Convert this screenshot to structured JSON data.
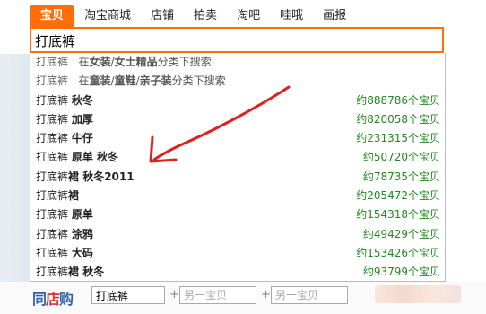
{
  "tabs": [
    "宝贝",
    "淘宝商城",
    "店铺",
    "拍卖",
    "淘吧",
    "哇哦",
    "画报"
  ],
  "search": {
    "value": "打底裤"
  },
  "categories": [
    {
      "term": "打底裤",
      "prefix": "在",
      "cats": [
        "女装",
        "女士精品"
      ],
      "suffix": "分类下搜索"
    },
    {
      "term": "打底裤",
      "prefix": "在",
      "cats": [
        "童装",
        "童鞋",
        "亲子装"
      ],
      "suffix": "分类下搜索"
    }
  ],
  "suggestions": [
    {
      "base": "打底裤",
      "extra": "秋冬",
      "count": "约888786个宝贝"
    },
    {
      "base": "打底裤",
      "extra": "加厚",
      "count": "约820058个宝贝"
    },
    {
      "base": "打底裤",
      "extra": "牛仔",
      "count": "约231315个宝贝"
    },
    {
      "base": "打底裤",
      "extra": "原单 秋冬",
      "count": "约50720个宝贝"
    },
    {
      "base": "打底裤",
      "extra": "裙 秋冬2011",
      "count": "约78735个宝贝"
    },
    {
      "base": "打底裤",
      "extra": "裙",
      "count": "约205472个宝贝"
    },
    {
      "base": "打底裤",
      "extra": "原单",
      "count": "约154318个宝贝"
    },
    {
      "base": "打底裤",
      "extra": "涂鸦",
      "count": "约49429个宝贝"
    },
    {
      "base": "打底裤",
      "extra": "大码",
      "count": "约153426个宝贝"
    },
    {
      "base": "打底裤",
      "extra": "裙 秋冬",
      "count": "约93799个宝贝"
    }
  ],
  "same_store": {
    "logo_part1": "同",
    "logo_part2": "店",
    "logo_part3": "购",
    "input1_value": "打底裤",
    "input2_placeholder": "另一宝贝",
    "input3_placeholder": "另一宝贝",
    "plus": "+"
  },
  "colors": {
    "accent": "#ff6e0a",
    "count_green": "#1f8a1f",
    "arrow_red": "#e02020"
  }
}
